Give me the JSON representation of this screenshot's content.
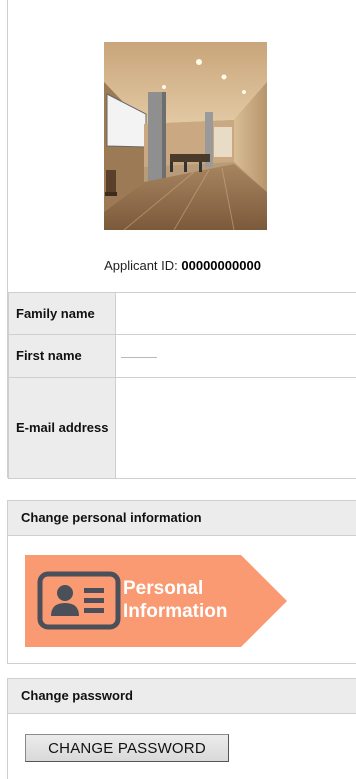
{
  "profile": {
    "photo_alt": "Applicant photo",
    "applicant_id_label": "Applicant ID:",
    "applicant_id_value": "00000000000",
    "fields": {
      "family_name_label": "Family name",
      "family_name_value": "",
      "first_name_label": "First name",
      "first_name_value": "",
      "email_label": "E-mail address",
      "email_value": ""
    }
  },
  "personal_section": {
    "header": "Change personal information",
    "banner_line1": "Personal",
    "banner_line2": "Information",
    "banner_color": "#f99a73",
    "icon_color": "#4a4f5a"
  },
  "password_section": {
    "header": "Change password",
    "button_label": "CHANGE PASSWORD"
  }
}
